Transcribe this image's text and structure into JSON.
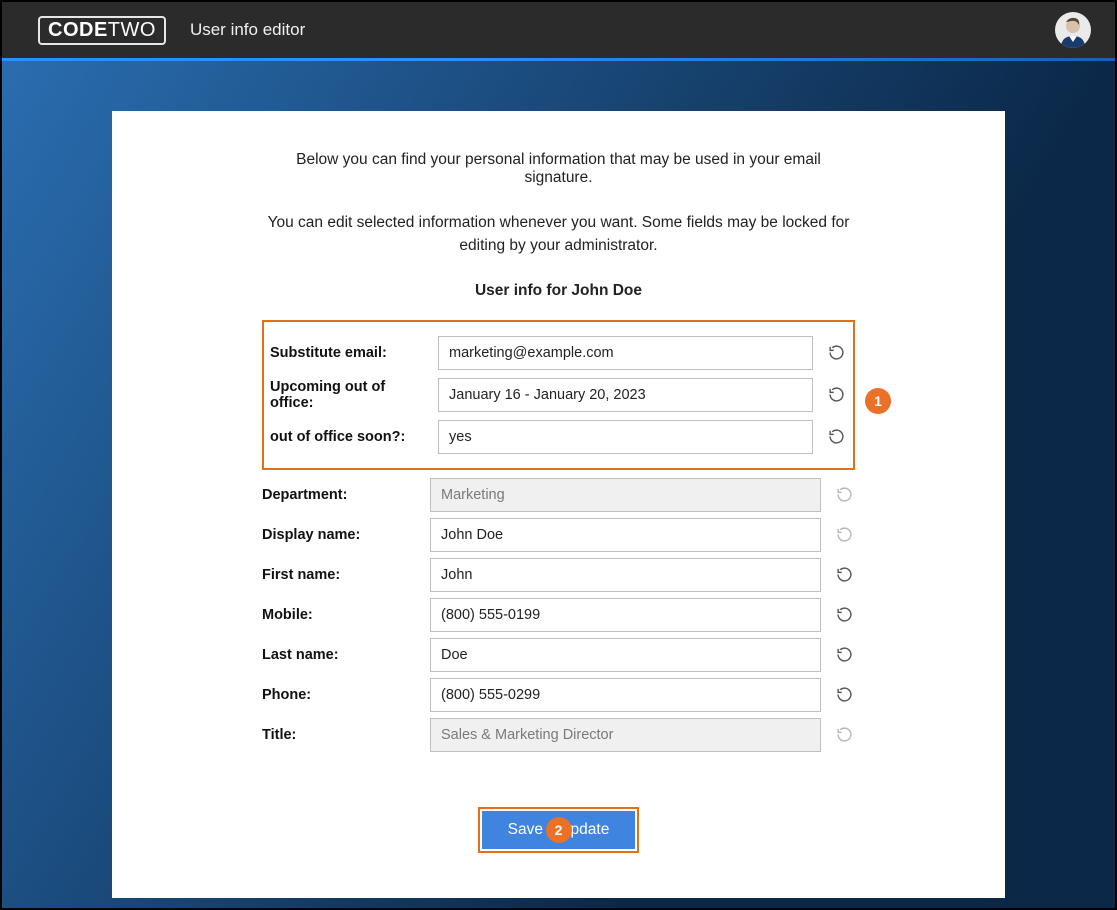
{
  "header": {
    "logo_bold": "CODE",
    "logo_light": "TWO",
    "app_title": "User info editor"
  },
  "intro_line1": "Below you can find your personal information that may be used in your email signature.",
  "intro_line2": "You can edit selected information whenever you want. Some fields may be locked for editing by your administrator.",
  "section_title": "User info for John Doe",
  "highlighted_fields": [
    {
      "label": "Substitute email:",
      "value": "marketing@example.com",
      "disabled": false
    },
    {
      "label": "Upcoming out of office:",
      "value": "January 16 - January 20, 2023",
      "disabled": false
    },
    {
      "label": "out of office soon?:",
      "value": "yes",
      "disabled": false
    }
  ],
  "fields": [
    {
      "label": "Department:",
      "value": "Marketing",
      "disabled": true
    },
    {
      "label": "Display name:",
      "value": "John Doe",
      "disabled": false
    },
    {
      "label": "First name:",
      "value": "John",
      "disabled": false
    },
    {
      "label": "Mobile:",
      "value": "(800) 555-0199",
      "disabled": false
    },
    {
      "label": "Last name:",
      "value": "Doe",
      "disabled": false
    },
    {
      "label": "Phone:",
      "value": "(800) 555-0299",
      "disabled": false
    },
    {
      "label": "Title:",
      "value": "Sales & Marketing Director",
      "disabled": true
    }
  ],
  "annotations": {
    "callout1": "1",
    "callout2": "2"
  },
  "buttons": {
    "save": "Save & update"
  }
}
